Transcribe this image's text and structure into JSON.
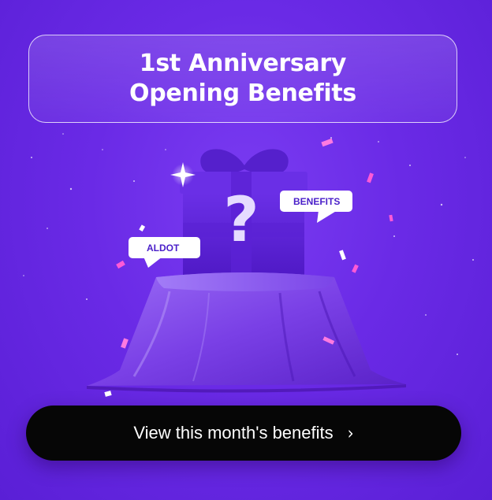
{
  "title": {
    "line1": "1st Anniversary",
    "line2": "Opening Benefits"
  },
  "bubbles": {
    "left_label": "ALDOT",
    "right_label": "BENEFITS"
  },
  "gift_mark": "?",
  "cta": {
    "label": "View this month's benefits",
    "chevron": "›"
  },
  "colors": {
    "background": "#6a2ae6",
    "cloth": "#7d45e6",
    "gift_box": "#5c23d6",
    "bubble_text": "#4a1fc9",
    "confetti": "#ff5ad6",
    "cta_bg": "#060606"
  }
}
